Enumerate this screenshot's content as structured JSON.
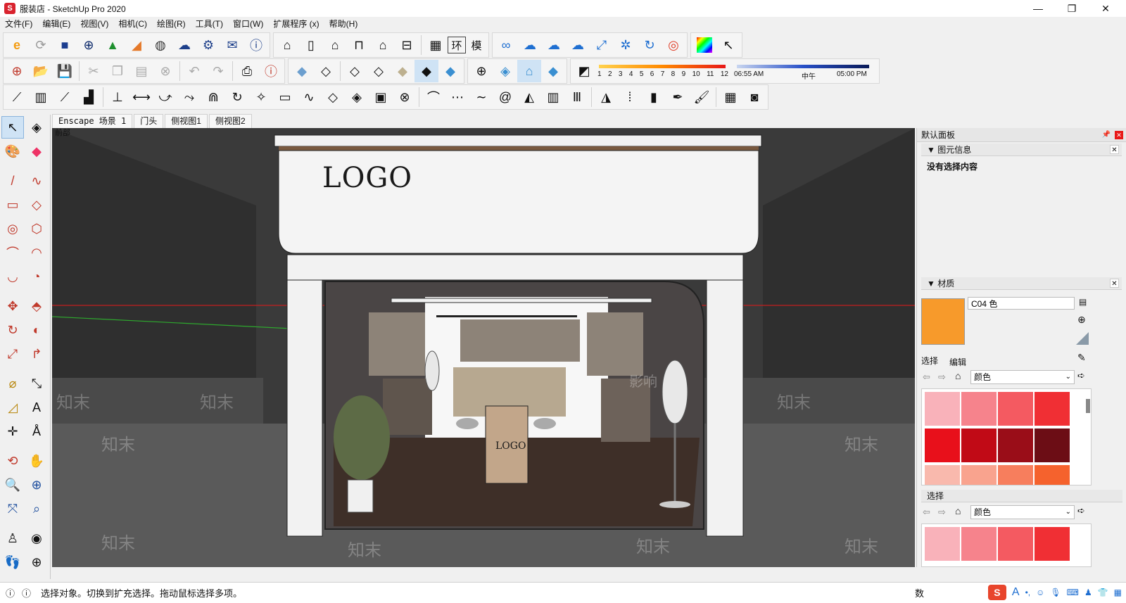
{
  "window": {
    "title": "服装店 - SketchUp Pro 2020",
    "minimize_label": "—",
    "restore_label": "❐",
    "close_label": "✕"
  },
  "menu": {
    "items": [
      {
        "label": "文件(F)"
      },
      {
        "label": "编辑(E)"
      },
      {
        "label": "视图(V)"
      },
      {
        "label": "相机(C)"
      },
      {
        "label": "绘图(R)"
      },
      {
        "label": "工具(T)"
      },
      {
        "label": "窗口(W)"
      },
      {
        "label": "扩展程序 (x)"
      },
      {
        "label": "帮助(H)"
      }
    ]
  },
  "toolbar_text": {
    "btn_huan": "环",
    "btn_mo": "模",
    "shadow_months": [
      "1",
      "2",
      "3",
      "4",
      "5",
      "6",
      "7",
      "8",
      "9",
      "10",
      "11",
      "12"
    ],
    "shadow_time_start": "06:55 AM",
    "shadow_time_mid": "中午",
    "shadow_time_end": "05:00 PM"
  },
  "scene_tabs": [
    {
      "label": "Enscape 场景 1"
    },
    {
      "label": "门头"
    },
    {
      "label": "侧视图1"
    },
    {
      "label": "侧视图2"
    }
  ],
  "viewport": {
    "view_label": "前部",
    "logo_top": "LOGO",
    "logo_counter": "LOGO",
    "watermark": "知末",
    "watermark_center": "影响"
  },
  "panel": {
    "title": "默认面板",
    "entity_info": {
      "header": "图元信息",
      "content": "没有选择内容"
    },
    "materials": {
      "header": "材质",
      "name_value": "C04 色",
      "tabs": [
        "选择",
        "编辑"
      ],
      "dropdown": "颜色",
      "current_color": "#f79a2b",
      "swatches": [
        "#f9b2ba",
        "#f6838c",
        "#f45a61",
        "#f02f34",
        "#e8101b",
        "#c10a16",
        "#9a0d18",
        "#6c0d15",
        "#f9b9ad",
        "#f9a38e",
        "#f77e5d",
        "#f5622d"
      ]
    },
    "select_secondary": {
      "header": "选择",
      "dropdown": "颜色",
      "swatches": [
        "#f9b2ba",
        "#f6838c",
        "#f45a61",
        "#f02f34"
      ]
    }
  },
  "status": {
    "text": "选择对象。切换到扩充选择。拖动鼠标选择多项。",
    "measure_label": "数"
  },
  "tray": {
    "ime_logo": "S",
    "ime_mode": "A"
  }
}
